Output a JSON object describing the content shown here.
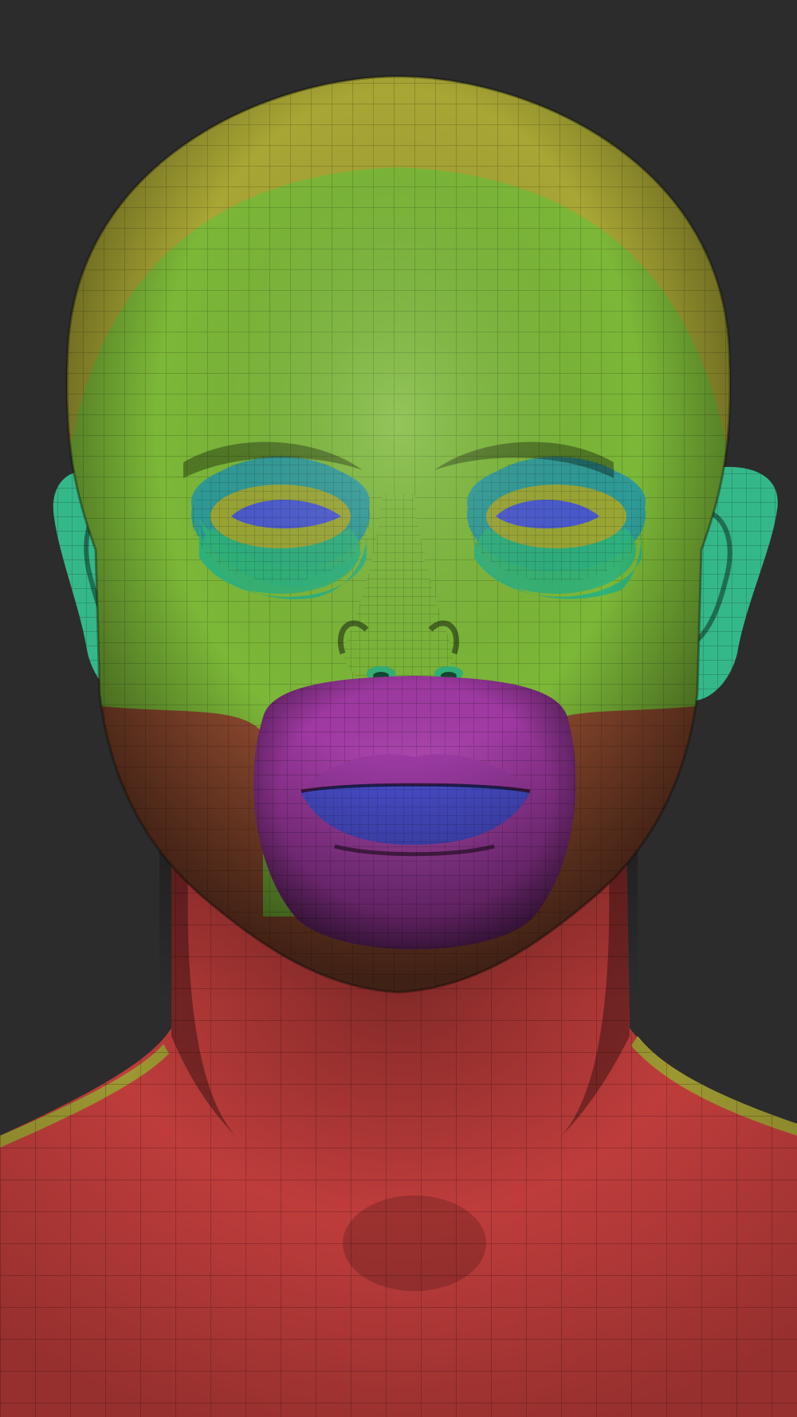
{
  "scene": {
    "background": "#2c2c2c",
    "subject": "sculpted-head-polygroups",
    "palette": {
      "scalp": "#a8a634",
      "face": "#7cb838",
      "eye-socket": "#2f9b96",
      "under-eye": "#2fb27b",
      "eyelid": "#9ba734",
      "eyeball": "#4a5acf",
      "ear": "#35b889",
      "mouth-region": "#a83cab",
      "lips": "#4a4fd0",
      "neck-torso": "#c8403e",
      "jaw": "#8f4a2e",
      "shoulder-strip": "#a5a034"
    },
    "mesh_wireframe": true
  }
}
